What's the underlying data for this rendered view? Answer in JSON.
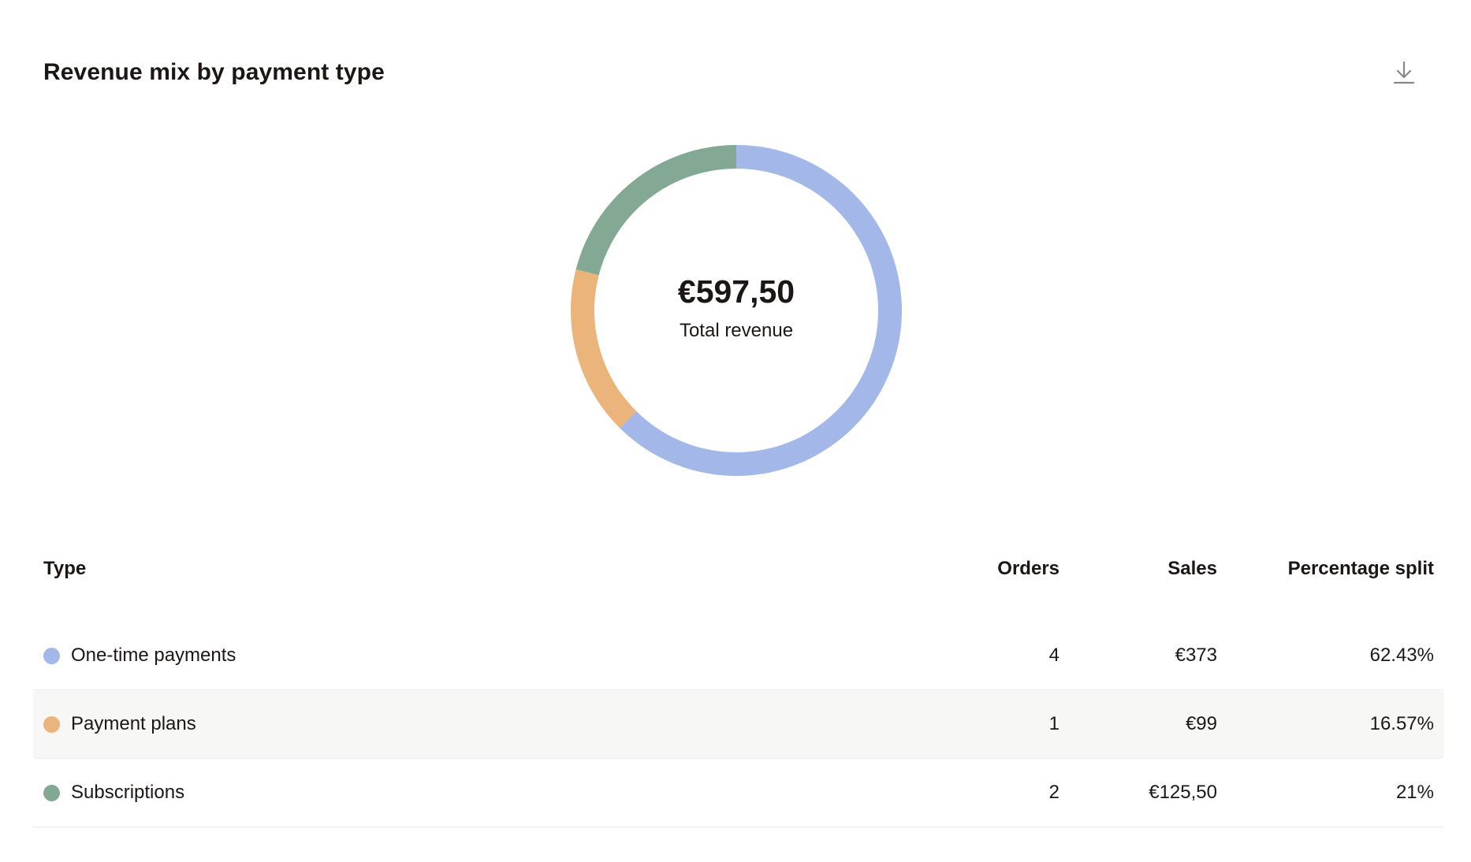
{
  "header": {
    "title": "Revenue mix by payment type",
    "download_icon": "download-icon"
  },
  "summary": {
    "total_value": "€597,50",
    "total_caption": "Total revenue"
  },
  "table": {
    "columns": {
      "type": "Type",
      "orders": "Orders",
      "sales": "Sales",
      "percentage": "Percentage split"
    },
    "rows": [
      {
        "type": "One-time payments",
        "orders": "4",
        "sales": "€373",
        "percentage": "62.43%",
        "color": "#a3b8e8"
      },
      {
        "type": "Payment plans",
        "orders": "1",
        "sales": "€99",
        "percentage": "16.57%",
        "color": "#eab47a"
      },
      {
        "type": "Subscriptions",
        "orders": "2",
        "sales": "€125,50",
        "percentage": "21%",
        "color": "#83a994"
      }
    ]
  },
  "chart_data": {
    "type": "pie",
    "categories": [
      "One-time payments",
      "Payment plans",
      "Subscriptions"
    ],
    "values": [
      62.43,
      16.57,
      21
    ],
    "colors": [
      "#a3b8e8",
      "#eab47a",
      "#83a994"
    ]
  }
}
